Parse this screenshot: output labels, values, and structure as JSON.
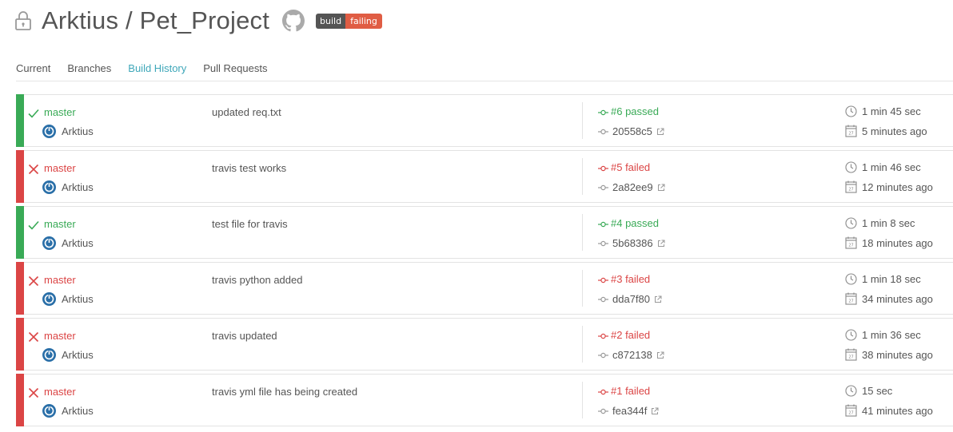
{
  "repo": {
    "title": "Arktius / Pet_Project",
    "badge_left": "build",
    "badge_right": "failing"
  },
  "tabs": [
    "Current",
    "Branches",
    "Build History",
    "Pull Requests"
  ],
  "active_tab": "Build History",
  "colors": {
    "passed": "#39aa56",
    "failed": "#db4545",
    "accent": "#3ea7b9"
  },
  "builds": [
    {
      "status": "passed",
      "branch": "master",
      "author": "Arktius",
      "message": "updated req.txt",
      "number": "#6 passed",
      "sha": "20558c5",
      "duration": "1 min 45 sec",
      "ago": "5 minutes ago"
    },
    {
      "status": "failed",
      "branch": "master",
      "author": "Arktius",
      "message": "travis test works",
      "number": "#5 failed",
      "sha": "2a82ee9",
      "duration": "1 min 46 sec",
      "ago": "12 minutes ago"
    },
    {
      "status": "passed",
      "branch": "master",
      "author": "Arktius",
      "message": "test file for travis",
      "number": "#4 passed",
      "sha": "5b68386",
      "duration": "1 min 8 sec",
      "ago": "18 minutes ago"
    },
    {
      "status": "failed",
      "branch": "master",
      "author": "Arktius",
      "message": "travis python added",
      "number": "#3 failed",
      "sha": "dda7f80",
      "duration": "1 min 18 sec",
      "ago": "34 minutes ago"
    },
    {
      "status": "failed",
      "branch": "master",
      "author": "Arktius",
      "message": "travis updated",
      "number": "#2 failed",
      "sha": "c872138",
      "duration": "1 min 36 sec",
      "ago": "38 minutes ago"
    },
    {
      "status": "failed",
      "branch": "master",
      "author": "Arktius",
      "message": "travis yml file has being created",
      "number": "#1 failed",
      "sha": "fea344f",
      "duration": "15 sec",
      "ago": "41 minutes ago"
    }
  ]
}
